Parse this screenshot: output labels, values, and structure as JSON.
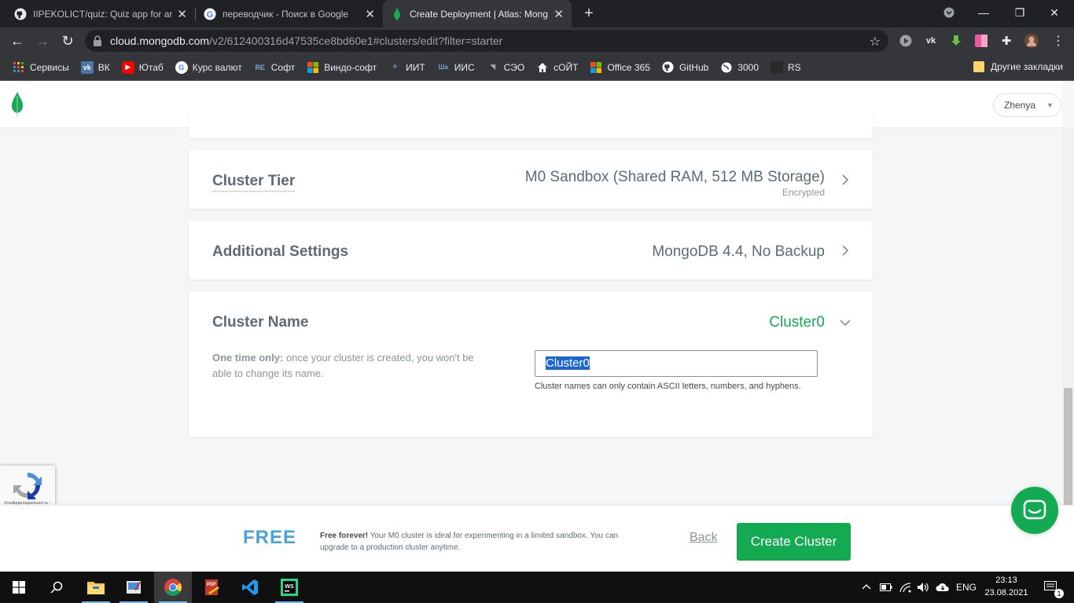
{
  "browser": {
    "tabs": [
      {
        "title": "IIPEKOLICT/quiz: Quiz app for an",
        "active": false
      },
      {
        "title": "переводчик - Поиск в Google",
        "active": false
      },
      {
        "title": "Create Deployment | Atlas: Mong",
        "active": true
      }
    ],
    "url_host": "cloud.mongodb.com",
    "url_path": "/v2/612400316d47535ce8bd60e1#clusters/edit?filter=starter",
    "bookmarks": [
      {
        "label": "Сервисы",
        "icon": "apps-grid-icon",
        "color": "#ea4335"
      },
      {
        "label": "ВК",
        "icon": "vk-icon",
        "color": "#4a76a8"
      },
      {
        "label": "Ютаб",
        "icon": "youtube-icon",
        "color": "#ff0000"
      },
      {
        "label": "Курс валют",
        "icon": "google-icon",
        "color": "#ffffff"
      },
      {
        "label": "Софт",
        "icon": "re-icon",
        "color": "#2b6cb0"
      },
      {
        "label": "Виндо-софт",
        "icon": "windows-icon",
        "color": "#f25022"
      },
      {
        "label": "ИИТ",
        "icon": "iit-icon",
        "color": "#3c78d8"
      },
      {
        "label": "ИИС",
        "icon": "iis-icon",
        "color": "#1e5aa8"
      },
      {
        "label": "СЭО",
        "icon": "seo-icon",
        "color": "#888888"
      },
      {
        "label": "сОЙТ",
        "icon": "home-icon",
        "color": "#ffffff"
      },
      {
        "label": "Office 365",
        "icon": "office-icon",
        "color": "#f25022"
      },
      {
        "label": "GitHub",
        "icon": "github-icon",
        "color": "#ffffff"
      },
      {
        "label": "3000",
        "icon": "globe-icon",
        "color": "#ffffff"
      },
      {
        "label": "RS",
        "icon": "rs-icon",
        "color": "#222222"
      }
    ],
    "other_bookmarks": "Другие закладки"
  },
  "app": {
    "user": "Zhenya",
    "cluster_tier": {
      "title": "Cluster Tier",
      "value": "M0 Sandbox (Shared RAM, 512 MB Storage)",
      "sub": "Encrypted"
    },
    "additional_settings": {
      "title": "Additional Settings",
      "value": "MongoDB 4.4, No Backup"
    },
    "cluster_name": {
      "title": "Cluster Name",
      "value": "Cluster0",
      "hint_bold": "One time only:",
      "hint_rest": " once your cluster is created, you won't be able to change its name.",
      "input_value": "Cluster0",
      "help": "Cluster names can only contain ASCII letters, numbers, and hyphens."
    },
    "recaptcha_text": "Конфиденциальность - Условия использования",
    "footer": {
      "free": "FREE",
      "text_bold": "Free forever!",
      "text_rest": " Your M0 cluster is ideal for experimenting in a limited sandbox. You can upgrade to a production cluster anytime.",
      "back": "Back",
      "create": "Create Cluster"
    },
    "colors": {
      "accent": "#13aa52",
      "free": "#49a5d9"
    }
  },
  "taskbar": {
    "language": "ENG",
    "time": "23:13",
    "date": "23.08.2021",
    "notifications": "1"
  }
}
